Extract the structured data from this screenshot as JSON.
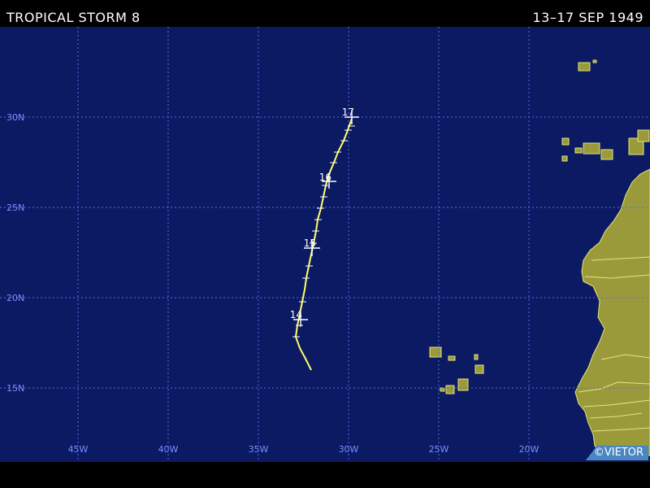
{
  "header": {
    "title": "TROPICAL STORM 8",
    "dates": "13–17 SEP 1949"
  },
  "map": {
    "colors": {
      "ocean": "#0b1a63",
      "land": "#9a9a3a",
      "coast": "#e6e67a",
      "grid": "#5a6ae6",
      "track": "#ffff66",
      "labels": "#7f8cff"
    },
    "lon_labels": [
      "45W",
      "40W",
      "35W",
      "30W",
      "25W",
      "20W"
    ],
    "lat_labels": [
      "30N",
      "25N",
      "20N",
      "15N"
    ],
    "day_labels": [
      "14",
      "15",
      "16",
      "17"
    ],
    "credit": "©VIETOR"
  }
}
